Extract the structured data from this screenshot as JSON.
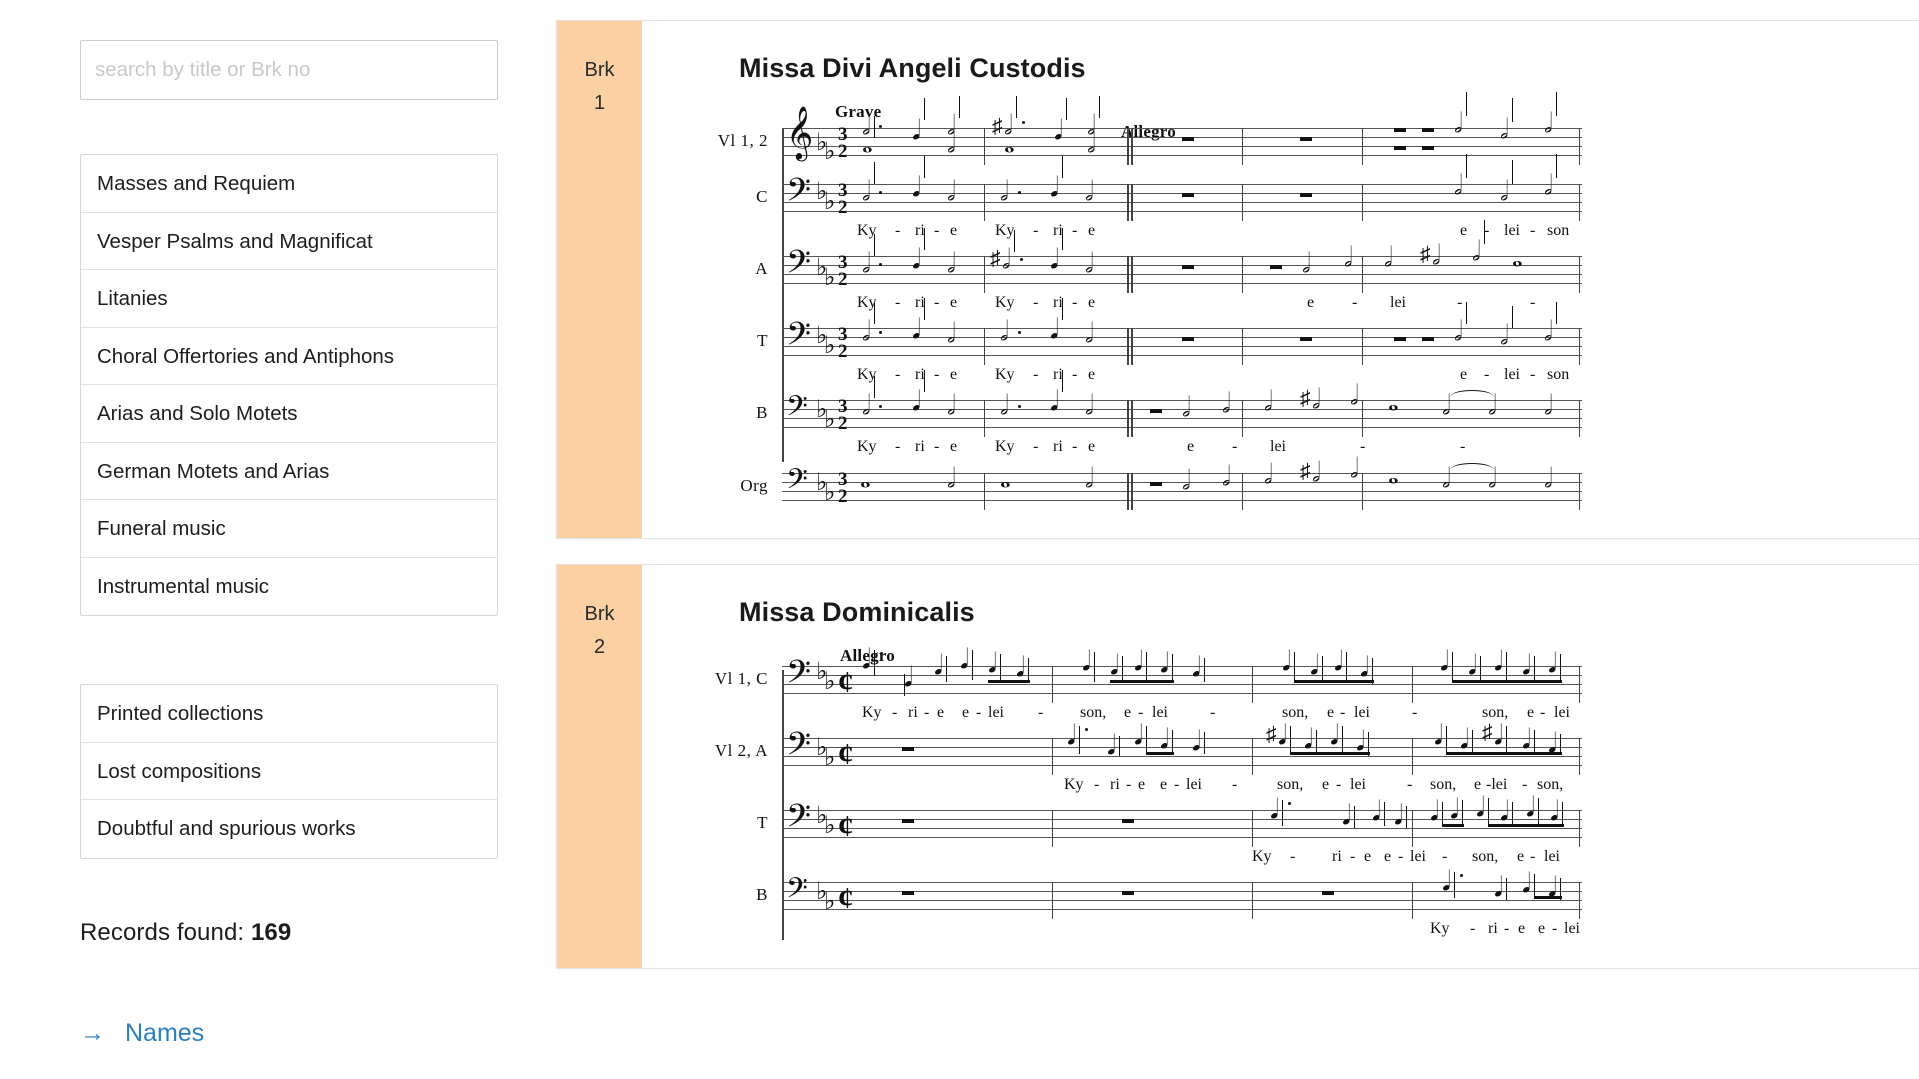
{
  "search": {
    "placeholder": "search by title or Brk no",
    "value": ""
  },
  "sidebar": {
    "genre_categories": [
      {
        "label": "Masses and Requiem"
      },
      {
        "label": "Vesper Psalms and Magnificat"
      },
      {
        "label": "Litanies"
      },
      {
        "label": "Choral Offertories and Antiphons"
      },
      {
        "label": "Arias and Solo Motets"
      },
      {
        "label": "German Motets and Arias"
      },
      {
        "label": "Funeral music"
      },
      {
        "label": "Instrumental music"
      }
    ],
    "source_categories": [
      {
        "label": "Printed collections"
      },
      {
        "label": "Lost compositions"
      },
      {
        "label": "Doubtful and spurious works"
      }
    ],
    "records_label": "Records found:",
    "records_count": "169",
    "names_link": {
      "arrow": "→",
      "label": "Names"
    }
  },
  "results": {
    "cards": [
      {
        "badge_prefix": "Brk",
        "badge_number": "1",
        "title": "Missa Divi Angeli Custodis",
        "incipit": {
          "tempo_marks": [
            "Grave",
            "Allegro"
          ],
          "time_signature": "3/2",
          "key_signature": "two flats",
          "staves": [
            {
              "label": "Vl 1, 2",
              "clef": "treble",
              "lyrics": []
            },
            {
              "label": "C",
              "clef": "c",
              "lyrics": [
                "Ky",
                "-",
                "ri",
                "-",
                "e",
                "Ky",
                "-",
                "ri",
                "-",
                "e",
                "e",
                "-",
                "lei",
                "-",
                "son"
              ]
            },
            {
              "label": "A",
              "clef": "c",
              "lyrics": [
                "Ky",
                "-",
                "ri",
                "-",
                "e",
                "Ky",
                "-",
                "ri",
                "-",
                "e",
                "e",
                "-",
                "lei",
                "-",
                "-"
              ]
            },
            {
              "label": "T",
              "clef": "c",
              "lyrics": [
                "Ky",
                "-",
                "ri",
                "-",
                "e",
                "Ky",
                "-",
                "ri",
                "-",
                "e",
                "e",
                "-",
                "lei",
                "-",
                "son"
              ]
            },
            {
              "label": "B",
              "clef": "bass",
              "lyrics": [
                "Ky",
                "-",
                "ri",
                "-",
                "e",
                "Ky",
                "-",
                "ri",
                "-",
                "e",
                "e",
                "-",
                "lei",
                "-",
                "-"
              ]
            },
            {
              "label": "Org",
              "clef": "bass",
              "lyrics": []
            }
          ]
        }
      },
      {
        "badge_prefix": "Brk",
        "badge_number": "2",
        "title": "Missa Dominicalis",
        "incipit": {
          "tempo_marks": [
            "Allegro"
          ],
          "time_signature": "cut-common",
          "key_signature": "two flats",
          "staves": [
            {
              "label": "Vl 1, C",
              "clef": "c",
              "lyrics": [
                "Ky",
                "-",
                "ri",
                "-",
                "e",
                "e",
                "-",
                "lei",
                "-",
                "son,",
                "e",
                "-",
                "lei",
                "-",
                "son,",
                "e",
                "-",
                "lei",
                "-",
                "son,",
                "e",
                "-",
                "lei"
              ]
            },
            {
              "label": "Vl 2, A",
              "clef": "c",
              "lyrics": [
                "Ky",
                "-",
                "ri",
                "-",
                "e",
                "e",
                "-",
                "lei",
                "-",
                "son,",
                "e",
                "-",
                "lei",
                "-",
                "son,",
                "e",
                "-lei",
                "-",
                "son,",
                "e",
                "-",
                "lei,"
              ]
            },
            {
              "label": "T",
              "clef": "c",
              "lyrics": [
                "Ky",
                "-",
                "ri",
                "-",
                "e",
                "e",
                "-",
                "lei",
                "-",
                "son,",
                "e",
                "-",
                "lei"
              ]
            },
            {
              "label": "B",
              "clef": "bass",
              "lyrics": [
                "Ky",
                "-",
                "ri",
                "-",
                "e",
                "e",
                "-",
                "lei"
              ]
            }
          ]
        }
      }
    ]
  },
  "colors": {
    "badge_background": "#fbd0a2",
    "link": "#2a7fc1",
    "text": "#1a1a1a",
    "border": "#e3e3e3"
  }
}
